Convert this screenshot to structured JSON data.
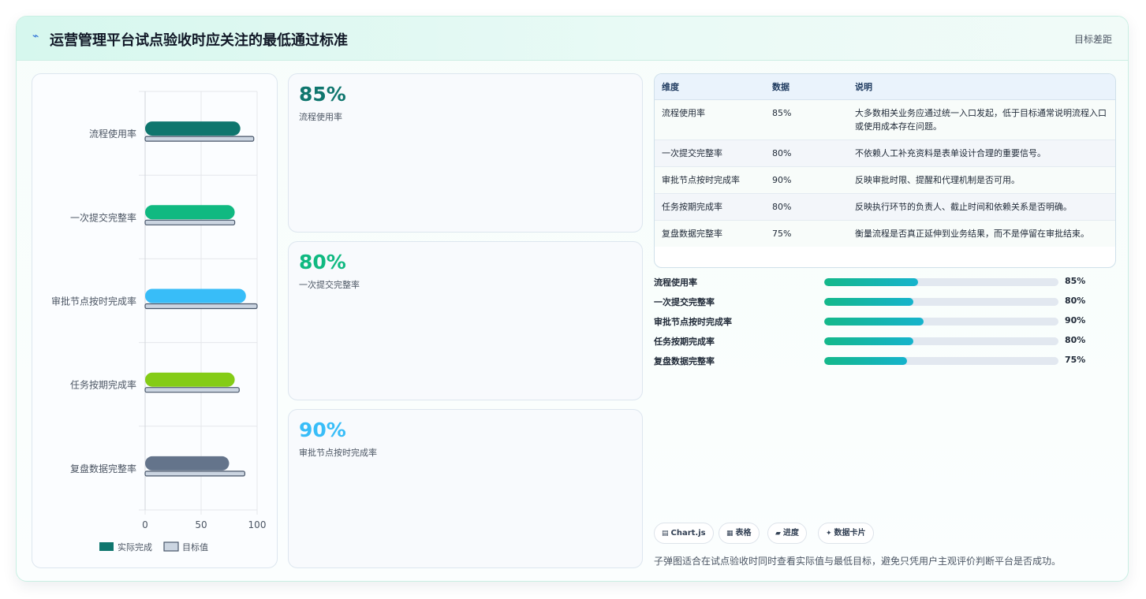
{
  "header": {
    "title": "运营管理平台试点验收时应关注的最低通过标准",
    "link": "目标差距"
  },
  "chart_data": {
    "type": "bar",
    "orientation": "horizontal",
    "categories": [
      "流程使用率",
      "一次提交完整率",
      "审批节点按时完成率",
      "任务按期完成率",
      "复盘数据完整率"
    ],
    "series": [
      {
        "name": "实际完成",
        "values": [
          85,
          80,
          90,
          80,
          75
        ],
        "colors": [
          "#0f766e",
          "#10b981",
          "#38bdf8",
          "#84cc16",
          "#64748b"
        ]
      },
      {
        "name": "目标值",
        "values": [
          97,
          80,
          100,
          84,
          89
        ],
        "color": "#cbd5e1"
      }
    ],
    "xlim": [
      0,
      100
    ],
    "xticks": [
      0,
      50,
      100
    ],
    "grid": true,
    "legend": "bottom"
  },
  "stats": [
    {
      "value": "85%",
      "label": "流程使用率",
      "color": "#0f766e"
    },
    {
      "value": "80%",
      "label": "一次提交完整率",
      "color": "#10b981"
    },
    {
      "value": "90%",
      "label": "审批节点按时完成率",
      "color": "#38bdf8"
    }
  ],
  "table": {
    "headers": [
      "维度",
      "数据",
      "说明"
    ],
    "rows": [
      [
        "流程使用率",
        "85%",
        "大多数相关业务应通过统一入口发起，低于目标通常说明流程入口或使用成本存在问题。"
      ],
      [
        "一次提交完整率",
        "80%",
        "不依赖人工补充资料是表单设计合理的重要信号。"
      ],
      [
        "审批节点按时完成率",
        "90%",
        "反映审批时限、提醒和代理机制是否可用。"
      ],
      [
        "任务按期完成率",
        "80%",
        "反映执行环节的负责人、截止时间和依赖关系是否明确。"
      ],
      [
        "复盘数据完整率",
        "75%",
        "衡量流程是否真正延伸到业务结果，而不是停留在审批结束。"
      ]
    ]
  },
  "progress": [
    {
      "label": "流程使用率",
      "text": "85%",
      "fraction": 0.4
    },
    {
      "label": "一次提交完整率",
      "text": "80%",
      "fraction": 0.38
    },
    {
      "label": "审批节点按时完成率",
      "text": "90%",
      "fraction": 0.425
    },
    {
      "label": "任务按期完成率",
      "text": "80%",
      "fraction": 0.38
    },
    {
      "label": "复盘数据完整率",
      "text": "75%",
      "fraction": 0.355
    }
  ],
  "chips": [
    {
      "icon": "chart-icon",
      "glyph": "▤",
      "label": "Chart.js"
    },
    {
      "icon": "table-icon",
      "glyph": "▦",
      "label": "表格"
    },
    {
      "icon": "progress-icon",
      "glyph": "▰",
      "label": "进度"
    },
    {
      "icon": "sparkle-icon",
      "glyph": "✦",
      "label": "数据卡片"
    }
  ],
  "footnote": "子弹图适合在试点验收时同时查看实际值与最低目标，避免只凭用户主观评价判断平台是否成功。"
}
